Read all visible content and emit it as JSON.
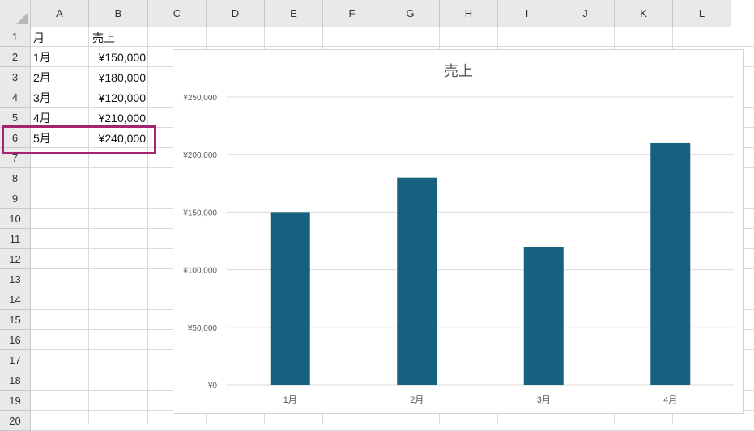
{
  "columns": [
    "A",
    "B",
    "C",
    "D",
    "E",
    "F",
    "G",
    "H",
    "I",
    "J",
    "K",
    "L"
  ],
  "rows": [
    "1",
    "2",
    "3",
    "4",
    "5",
    "6",
    "7",
    "8",
    "9",
    "10",
    "11",
    "12",
    "13",
    "14",
    "15",
    "16",
    "17",
    "18",
    "19",
    "20"
  ],
  "cells": {
    "A1": "月",
    "B1": "売上",
    "A2": "1月",
    "B2": "¥150,000",
    "A3": "2月",
    "B3": "¥180,000",
    "A4": "3月",
    "B4": "¥120,000",
    "A5": "4月",
    "B5": "¥210,000",
    "A6": "5月",
    "B6": "¥240,000"
  },
  "highlight_color": "#a3246f",
  "chart_data": {
    "type": "bar",
    "title": "売上",
    "categories": [
      "1月",
      "2月",
      "3月",
      "4月"
    ],
    "values": [
      150000,
      180000,
      120000,
      210000
    ],
    "ylim": [
      0,
      250000
    ],
    "yticks": [
      "¥0",
      "¥50,000",
      "¥100,000",
      "¥150,000",
      "¥200,000",
      "¥250,000"
    ],
    "grid": true,
    "bar_color": "#17607f"
  }
}
